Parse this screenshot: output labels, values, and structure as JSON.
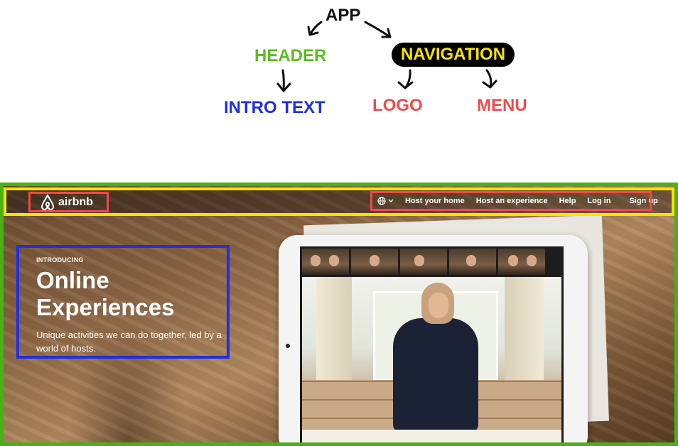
{
  "tree": {
    "app": "APP",
    "header": "HEADER",
    "navigation": "NAVIGATION",
    "intro_text": "INTRO TEXT",
    "logo": "LOGO",
    "menu": "MENU"
  },
  "screenshot": {
    "logo_text": "airbnb",
    "nav": {
      "items": [
        "Host your home",
        "Host an experience",
        "Help",
        "Log in",
        "Sign up"
      ]
    },
    "intro": {
      "eyebrow": "INTRODUCING",
      "title": "Online Experiences",
      "description": "Unique activities we can do together, led by a world of hosts."
    }
  },
  "colors": {
    "app": "#49b015",
    "header": "#f7e400",
    "logo_menu": "#ef4a4a",
    "intro": "#1f2ee6",
    "navigation_pill": "#000000"
  },
  "icons": {
    "logo": "airbnb-logo-icon",
    "language": "globe-icon",
    "dropdown": "chevron-down-icon"
  }
}
